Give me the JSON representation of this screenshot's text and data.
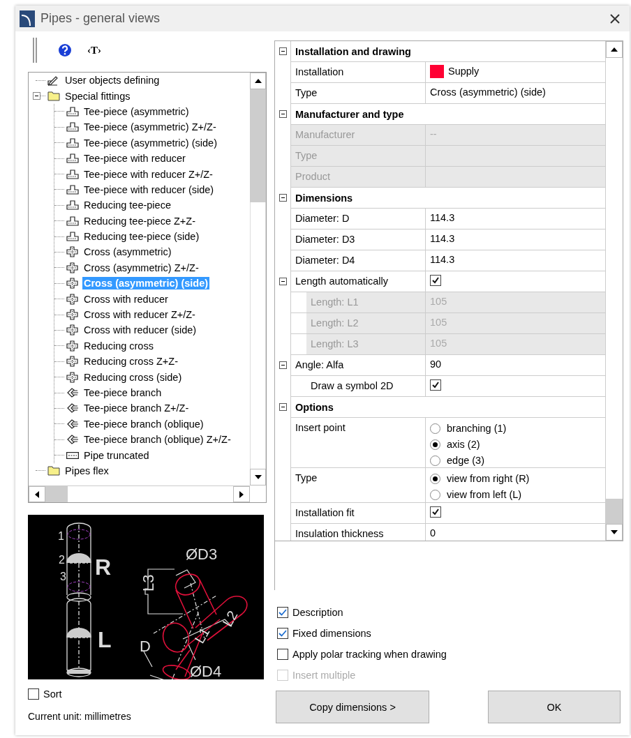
{
  "window": {
    "title": "Pipes - general views"
  },
  "toolbar": {
    "text_button": "‹T›"
  },
  "tree": {
    "items": [
      {
        "label": "User objects defining",
        "kind": "pen",
        "selected": false
      },
      {
        "label": "Special fittings",
        "kind": "folder",
        "selected": false,
        "expanded": true,
        "children": [
          {
            "label": "Tee-piece (asymmetric)",
            "kind": "tee",
            "selected": false
          },
          {
            "label": "Tee-piece (asymmetric) Z+/Z-",
            "kind": "tee",
            "selected": false
          },
          {
            "label": "Tee-piece (asymmetric) (side)",
            "kind": "tee",
            "selected": false
          },
          {
            "label": "Tee-piece with reducer",
            "kind": "tee",
            "selected": false
          },
          {
            "label": "Tee-piece with reducer Z+/Z-",
            "kind": "tee",
            "selected": false
          },
          {
            "label": "Tee-piece with reducer (side)",
            "kind": "tee",
            "selected": false
          },
          {
            "label": "Reducing tee-piece",
            "kind": "tee",
            "selected": false
          },
          {
            "label": "Reducing tee-piece Z+Z-",
            "kind": "tee",
            "selected": false
          },
          {
            "label": "Reducing tee-piece (side)",
            "kind": "tee",
            "selected": false
          },
          {
            "label": "Cross (asymmetric)",
            "kind": "cross",
            "selected": false
          },
          {
            "label": "Cross (asymmetric) Z+/Z-",
            "kind": "cross",
            "selected": false
          },
          {
            "label": "Cross (asymmetric) (side)",
            "kind": "cross",
            "selected": true
          },
          {
            "label": "Cross with reducer",
            "kind": "cross",
            "selected": false
          },
          {
            "label": "Cross with reducer Z+/Z-",
            "kind": "cross",
            "selected": false
          },
          {
            "label": "Cross with reducer (side)",
            "kind": "cross",
            "selected": false
          },
          {
            "label": "Reducing cross",
            "kind": "cross",
            "selected": false
          },
          {
            "label": "Reducing cross Z+Z-",
            "kind": "cross",
            "selected": false
          },
          {
            "label": "Reducing cross (side)",
            "kind": "cross",
            "selected": false
          },
          {
            "label": "Tee-piece branch",
            "kind": "branch",
            "selected": false
          },
          {
            "label": "Tee-piece branch Z+/Z-",
            "kind": "branch",
            "selected": false
          },
          {
            "label": "Tee-piece branch (oblique)",
            "kind": "branch",
            "selected": false
          },
          {
            "label": "Tee-piece branch (oblique) Z+/Z-",
            "kind": "branch",
            "selected": false
          },
          {
            "label": "Pipe truncated",
            "kind": "pipe",
            "selected": false
          }
        ]
      },
      {
        "label": "Pipes flex",
        "kind": "folder",
        "selected": false
      }
    ]
  },
  "preview": {
    "labels": [
      "1",
      "2",
      "3",
      "R",
      "L",
      "ØD3",
      "L3",
      "D",
      "L1",
      "L2",
      "ØD4"
    ]
  },
  "sort": {
    "label": "Sort",
    "checked": false
  },
  "current_unit": "Current unit: millimetres",
  "property_grid": {
    "sections": [
      {
        "title": "Installation and drawing",
        "expanded": true,
        "rows": [
          {
            "kind": "color",
            "label": "Installation",
            "value": "Supply",
            "color": "#ff0033",
            "disabled": false
          },
          {
            "kind": "text",
            "label": "Type",
            "value": "Cross (asymmetric) (side)",
            "disabled": false
          }
        ]
      },
      {
        "title": "Manufacturer and type",
        "expanded": true,
        "rows": [
          {
            "kind": "text",
            "label": "Manufacturer",
            "value": "--",
            "disabled": true
          },
          {
            "kind": "text",
            "label": "Type",
            "disabled": true
          },
          {
            "kind": "text",
            "label": "Product",
            "disabled": true
          }
        ]
      },
      {
        "title": "Dimensions",
        "expanded": true,
        "rows": [
          {
            "kind": "text",
            "label": "Diameter: D",
            "value": "114.3",
            "disabled": false
          },
          {
            "kind": "text",
            "label": "Diameter: D3",
            "value": "114.3",
            "disabled": false
          },
          {
            "kind": "text",
            "label": "Diameter: D4",
            "value": "114.3",
            "disabled": false
          },
          {
            "kind": "check",
            "label": "Length automatically",
            "checked": true,
            "disabled": false,
            "expanded": true,
            "children": [
              {
                "kind": "text",
                "label": "Length: L1",
                "value": "105",
                "disabled": true
              },
              {
                "kind": "text",
                "label": "Length: L2",
                "value": "105",
                "disabled": true
              },
              {
                "kind": "text",
                "label": "Length: L3",
                "value": "105",
                "disabled": true
              }
            ]
          },
          {
            "kind": "text",
            "label": "Angle: Alfa",
            "value": "90",
            "disabled": false,
            "expanded": true,
            "children": [
              {
                "kind": "check",
                "label": "Draw a symbol 2D",
                "checked": true,
                "disabled": false
              }
            ]
          }
        ]
      },
      {
        "title": "Options",
        "expanded": true,
        "rows": [
          {
            "kind": "radio",
            "label": "Insert point",
            "disabled": false,
            "options": [
              {
                "label": "branching (1)",
                "selected": false
              },
              {
                "label": "axis (2)",
                "selected": true
              },
              {
                "label": "edge (3)",
                "selected": false
              }
            ]
          },
          {
            "kind": "radio",
            "label": "Type",
            "disabled": false,
            "options": [
              {
                "label": "view from right (R)",
                "selected": true
              },
              {
                "label": "view from left (L)",
                "selected": false
              }
            ]
          },
          {
            "kind": "check",
            "label": "Installation fit",
            "checked": true,
            "disabled": false
          },
          {
            "kind": "text",
            "label": "Insulation thickness",
            "value": "0",
            "disabled": false
          }
        ]
      }
    ]
  },
  "options": [
    {
      "label": "Description",
      "checked": true,
      "disabled": false
    },
    {
      "label": "Fixed dimensions",
      "checked": true,
      "disabled": false
    },
    {
      "label": "Apply polar tracking when drawing",
      "checked": false,
      "disabled": false
    },
    {
      "label": "Insert multiple",
      "checked": false,
      "disabled": true
    }
  ],
  "buttons": [
    {
      "label": "Copy dimensions >"
    },
    {
      "label": "OK"
    }
  ]
}
